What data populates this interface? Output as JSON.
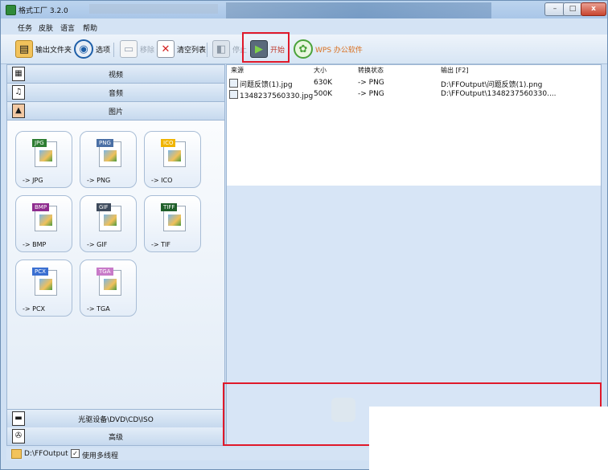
{
  "window": {
    "title": "格式工厂 3.2.0"
  },
  "menu": [
    "任务",
    "皮肤",
    "语言",
    "帮助"
  ],
  "toolbar": {
    "output_folder": "输出文件夹",
    "options": "选项",
    "remove": "移除",
    "clear_list": "清空列表",
    "stop": "停止",
    "start": "开始",
    "wps": "WPS 办公软件"
  },
  "categories": {
    "video": "视频",
    "audio": "音频",
    "image": "图片",
    "optical": "光驱设备\\DVD\\CD\\ISO",
    "advanced": "高级"
  },
  "image_formats": [
    {
      "badge": "JPG",
      "label": "-> JPG",
      "color": "#2e7d32"
    },
    {
      "badge": "PNG",
      "label": "-> PNG",
      "color": "#4a6fa5"
    },
    {
      "badge": "ICO",
      "label": "-> ICO",
      "color": "#f0b400"
    },
    {
      "badge": "BMP",
      "label": "-> BMP",
      "color": "#8e2c8e"
    },
    {
      "badge": "GIF",
      "label": "-> GIF",
      "color": "#3d4a5c"
    },
    {
      "badge": "TIFF",
      "label": "-> TIF",
      "color": "#1f5f2a"
    },
    {
      "badge": "PCX",
      "label": "-> PCX",
      "color": "#3a6fd1"
    },
    {
      "badge": "TGA",
      "label": "-> TGA",
      "color": "#c87ac8"
    }
  ],
  "file_list": {
    "columns": [
      "来源",
      "大小",
      "转换状态",
      "输出 [F2]"
    ],
    "rows": [
      {
        "source": "问题反馈(1).jpg",
        "size": "630K",
        "status": "-> PNG",
        "output": "D:\\FFOutput\\问题反馈(1).png"
      },
      {
        "source": "1348237560330.jpg",
        "size": "500K",
        "status": "-> PNG",
        "output": "D:\\FFOutput\\1348237560330...."
      }
    ]
  },
  "status": {
    "output_path": "D:\\FFOutput",
    "multithread_label": "使用多线程",
    "multithread_checked": true
  },
  "colors": {
    "highlight_box": "#e0192a",
    "accent": "#4c78a8"
  }
}
